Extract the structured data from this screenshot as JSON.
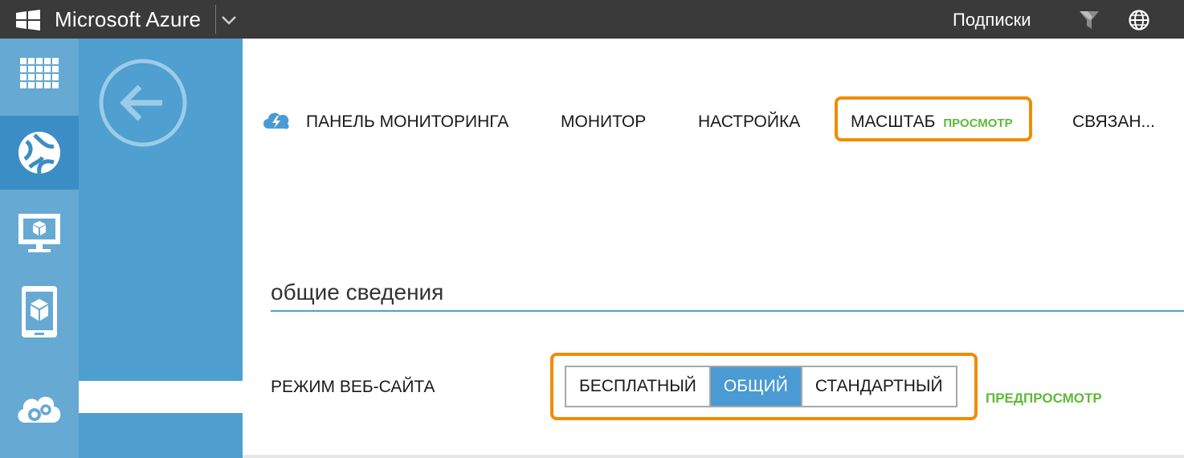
{
  "topbar": {
    "app_title": "Microsoft Azure",
    "subscriptions_label": "Подписки",
    "icons": [
      "windows-logo-icon",
      "chevron-down-icon",
      "filter-icon",
      "globe-icon"
    ]
  },
  "rail": {
    "items": [
      {
        "icon": "all-items-grid-icon",
        "active": false
      },
      {
        "icon": "web-sites-globe-icon",
        "active": true
      },
      {
        "icon": "virtual-machines-icon",
        "active": false
      },
      {
        "icon": "mobile-services-icon",
        "active": false
      },
      {
        "icon": "cloud-services-icon",
        "active": false
      }
    ]
  },
  "panel": {
    "back_icon": "back-arrow-icon"
  },
  "tabs": {
    "dashboard": "ПАНЕЛЬ МОНИТОРИНГА",
    "monitor": "МОНИТОР",
    "configure": "НАСТРОЙКА",
    "scale": "МАСШТАБ",
    "scale_badge": "ПРОСМОТР",
    "linked": "СВЯЗАН..."
  },
  "section": {
    "title": "общие сведения"
  },
  "mode": {
    "label": "РЕЖИМ ВЕБ-САЙТА",
    "options": [
      "БЕСПЛАТНЫЙ",
      "ОБЩИЙ",
      "СТАНДАРТНЫЙ"
    ],
    "selected": "ОБЩИЙ",
    "preview_badge": "ПРЕДПРОСМОТР"
  },
  "colors": {
    "topbar": "#3a3a3a",
    "rail": "#66a9d3",
    "panel": "#4f9fd0",
    "highlight": "#f08c00",
    "preview_green": "#5fb93a",
    "selected_segment": "#4a9ad4"
  }
}
